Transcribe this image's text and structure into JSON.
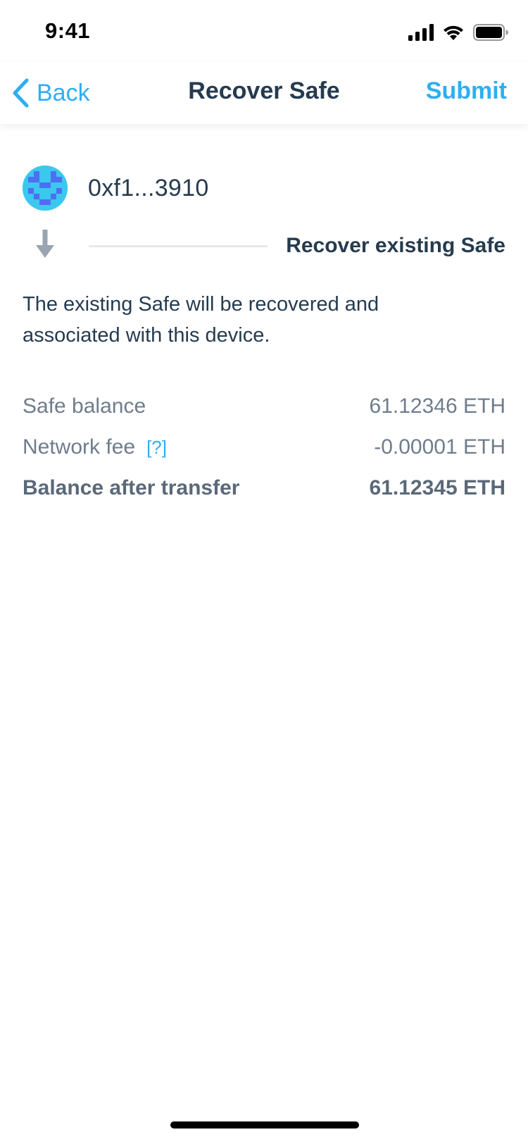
{
  "status_bar": {
    "time": "9:41",
    "icons": [
      "signal-icon",
      "wifi-icon",
      "battery-icon"
    ]
  },
  "nav": {
    "back_label": "Back",
    "title": "Recover Safe",
    "submit_label": "Submit"
  },
  "safe": {
    "address": "0xf1...3910",
    "avatar_icon": "identicon"
  },
  "step": {
    "icon": "arrow-down-icon",
    "label": "Recover existing Safe"
  },
  "description": "The existing Safe will be recovered and associated with this device.",
  "summary": {
    "safe_balance_label": "Safe balance",
    "safe_balance_value": "61.12346 ETH",
    "network_fee_label": "Network fee",
    "network_fee_help": "[?]",
    "network_fee_value": "-0.00001 ETH",
    "balance_after_label": "Balance after transfer",
    "balance_after_value": "61.12345 ETH"
  },
  "colors": {
    "accent": "#2eaff0",
    "text_primary": "#253b4f",
    "text_secondary": "#6f7c8c",
    "avatar_bg": "#3ac8ef",
    "avatar_pattern": "#4f6ef2"
  }
}
